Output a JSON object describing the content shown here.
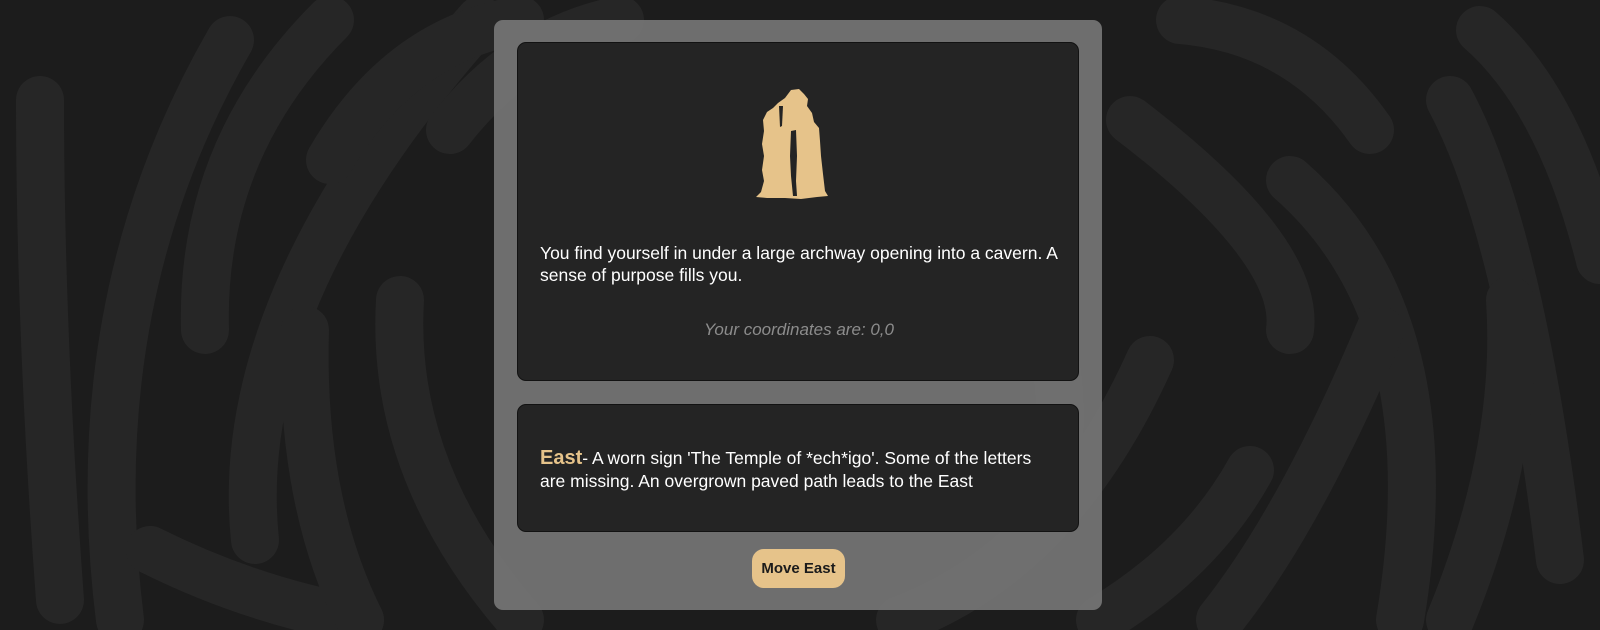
{
  "theme": {
    "background": "#1c1c1c",
    "panel": "#808080",
    "card": "#242424",
    "accent": "#e6c38a",
    "text": "#ffffff",
    "muted": "#8c8c8c"
  },
  "location": {
    "icon": "standing-stone-archway-icon",
    "description": "You find yourself in under a large archway opening into a cavern. A sense of purpose fills you.",
    "coordinates": "Your coordinates are: 0,0"
  },
  "exits": [
    {
      "direction": "East",
      "description": "- A worn sign 'The Temple of *ech*igo'. Some of the letters are missing. An overgrown paved path leads to the East"
    }
  ],
  "actions": {
    "move_label": "Move East"
  }
}
